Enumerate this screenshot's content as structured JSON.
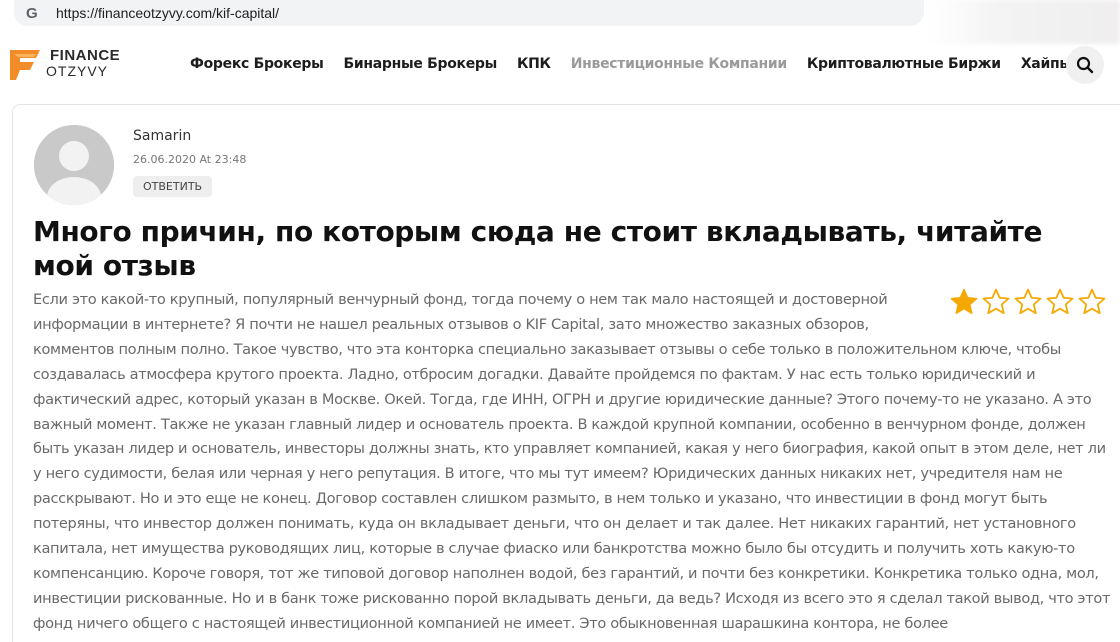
{
  "browser": {
    "url": "https://financeotzyvy.com/kif-capital/"
  },
  "logo": {
    "line1": "FINANCE",
    "line2": "OTZYVY",
    "accent_color": "#f28c28"
  },
  "nav": {
    "items": [
      {
        "label": "Форекс Брокеры"
      },
      {
        "label": "Бинарные Брокеры"
      },
      {
        "label": "КПК"
      },
      {
        "label": "Инвестиционные Компании",
        "active": true
      },
      {
        "label": "Криптовалютные Биржи"
      },
      {
        "label": "Хайпы"
      }
    ]
  },
  "review": {
    "author": "Samarin",
    "date": "26.06.2020 At 23:48",
    "reply_label": "ОТВЕТИТЬ",
    "title": "Много причин, по которым сюда не стоит вкладывать, читайте мой отзыв",
    "rating": 1,
    "rating_max": 5,
    "star_color": "#f5a800",
    "body": "Если это какой-то крупный, популярный венчурный фонд, тогда почему о нем так мало настоящей и достоверной информации в интернете? Я почти не нашел реальных отзывов о KIF Capital, зато множество заказных обзоров, комментов полным полно. Такое чувство, что эта конторка специально заказывает отзывы о себе только в положительном ключе, чтобы создавалась атмосфера крутого проекта. Ладно, отбросим догадки. Давайте пройдемся по фактам. У нас есть только юридический и фактический адрес, который указан в Москве. Окей. Тогда, где ИНН, ОГРН и другие юридические данные? Этого почему-то не указано. А это важный момент. Также не указан главный лидер и основатель проекта. В каждой крупной компании, особенно в венчурном фонде, должен быть указан лидер и основатель, инвесторы должны знать, кто управляет компанией, какая у него биография, какой опыт в этом деле, нет ли у него судимости, белая или черная у него репутация. В итоге, что мы тут имеем? Юридических данных никаких нет, учредителя нам не расскрывают. Но и это еще не конец. Договор составлен слишком размыто, в нем только и указано, что инвестиции в фонд могут быть потеряны, что инвестор должен понимать, куда он вкладывает деньги, что он делает и так далее. Нет никаких гарантий, нет установного капитала, нет имущества руководящих лиц, которые в случае фиаско или банкротства можно было бы отсудить и получить хоть какую-то компенсанцию. Короче говоря, тот же типовой договор наполнен водой, без гарантий, и почти без конкретики. Конкретика только одна, мол, инвестиции рискованные. Но и в банк тоже рискованно порой вкладывать деньги, да ведь? Исходя из всего это я сделал такой вывод, что этот фонд ничего общего с настоящей инвестиционной компанией не имеет. Это обыкновенная шарашкина контора, не более"
  }
}
